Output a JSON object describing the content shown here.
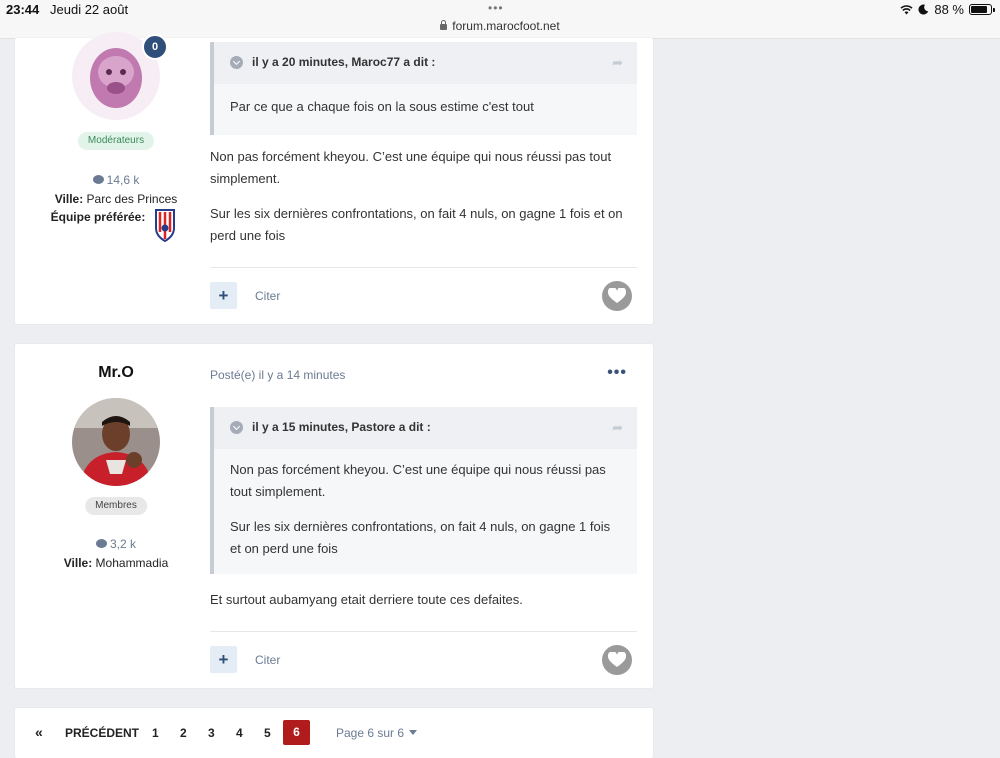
{
  "status_bar": {
    "time": "23:44",
    "date": "Jeudi 22 août",
    "dots": "•••",
    "url": "forum.marocfoot.net",
    "battery": "88 %",
    "battery_level": 0.88
  },
  "posts": [
    {
      "author": {
        "online_badge": "0",
        "group": "Modérateurs",
        "post_count": "14,6 k",
        "ville_label": "Ville:",
        "ville": "Parc des Princes",
        "equipe_label": "Équipe préférée:"
      },
      "quote": {
        "header": "il y a 20 minutes, Maroc77 a dit :",
        "paragraphs": [
          "Par ce que a chaque fois on la sous estime c'est tout"
        ]
      },
      "paragraphs": [
        "Non pas forcément kheyou. C’est une équipe qui nous réussi pas tout simplement.",
        "Sur les six dernières confrontations, on fait 4 nuls, on gagne 1 fois et on perd une fois"
      ],
      "plus_label": "+",
      "cite_label": "Citer"
    },
    {
      "author": {
        "name": "Mr.O",
        "group": "Membres",
        "post_count": "3,2 k",
        "ville_label": "Ville:",
        "ville": "Mohammadia"
      },
      "posted": "Posté(e) il y a 14 minutes",
      "more": "•••",
      "quote": {
        "header": "il y a 15 minutes, Pastore a dit :",
        "paragraphs": [
          "Non pas forcément kheyou. C’est une équipe qui nous réussi pas tout simplement.",
          "Sur les six dernières confrontations, on fait 4 nuls, on gagne 1 fois et on perd une fois"
        ]
      },
      "paragraphs": [
        "Et surtout aubamyang etait derriere toute ces defaites."
      ],
      "plus_label": "+",
      "cite_label": "Citer"
    }
  ],
  "pagination": {
    "first": "«",
    "prev": "PRÉCÉDENT",
    "pages": [
      "1",
      "2",
      "3",
      "4",
      "5"
    ],
    "current": "6",
    "info": "Page 6 sur 6"
  }
}
